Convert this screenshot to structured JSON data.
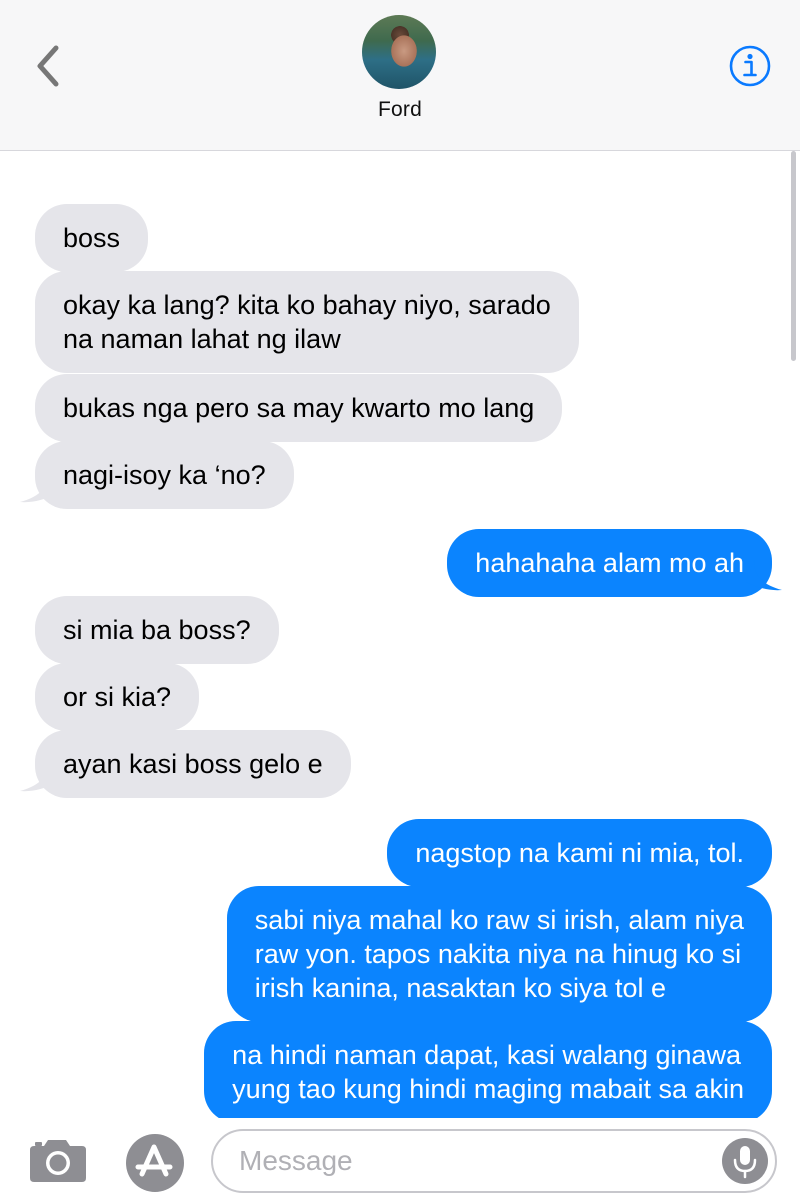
{
  "header": {
    "contact_name": "Ford",
    "back_icon": "chevron-left-icon",
    "info_icon": "info-icon"
  },
  "messages": [
    {
      "dir": "in",
      "text": "boss"
    },
    {
      "dir": "in",
      "text": "okay ka lang? kita ko bahay niyo, sarado\nna naman lahat ng ilaw"
    },
    {
      "dir": "in",
      "text": "bukas nga pero sa may kwarto mo lang"
    },
    {
      "dir": "in",
      "text": "nagi-isoy ka ‘no?"
    },
    {
      "dir": "out",
      "text": "hahahaha alam mo ah"
    },
    {
      "dir": "in",
      "text": "si mia ba boss?"
    },
    {
      "dir": "in",
      "text": "or si kia?"
    },
    {
      "dir": "in",
      "text": "ayan kasi boss gelo e"
    },
    {
      "dir": "out",
      "text": "nagstop na kami ni mia, tol."
    },
    {
      "dir": "out",
      "text": "sabi niya mahal ko raw si irish, alam niya\nraw yon. tapos nakita niya na hinug ko si\nirish kanina, nasaktan ko siya tol e"
    },
    {
      "dir": "out",
      "text": "na hindi naman dapat, kasi walang ginawa\nyung tao kung hindi maging mabait sa akin"
    }
  ],
  "input": {
    "placeholder": "Message",
    "camera_icon": "camera-icon",
    "apps_icon": "app-store-icon",
    "mic_icon": "microphone-icon"
  },
  "colors": {
    "incoming_bubble": "#e5e5ea",
    "outgoing_bubble": "#0b84fe",
    "accent": "#0a7aff"
  }
}
